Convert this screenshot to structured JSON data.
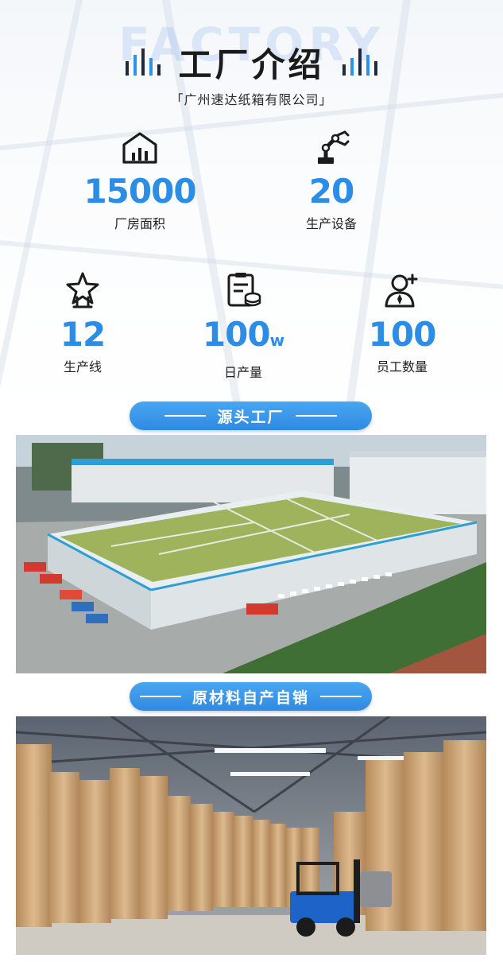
{
  "header": {
    "watermark": "FACTORY",
    "title": "工厂介绍",
    "subtitle": "「广州速达纸箱有限公司」"
  },
  "stats": [
    {
      "number": "15000",
      "label": "厂房面积",
      "icon": "factory-chart-icon"
    },
    {
      "number": "20",
      "label": "生产设备",
      "icon": "robot-arm-icon"
    },
    {
      "number": "12",
      "label": "生产线",
      "icon": "star-hand-icon"
    },
    {
      "number": "100",
      "unit": "w",
      "label": "日产量",
      "icon": "clipboard-coins-icon"
    },
    {
      "number": "100",
      "label": "员工数量",
      "icon": "staff-add-icon"
    }
  ],
  "sections": [
    {
      "label": "源头工厂"
    },
    {
      "label": "原材料自产自销"
    }
  ],
  "colors": {
    "accent": "#2e8ee6",
    "title": "#1b1b1b"
  }
}
